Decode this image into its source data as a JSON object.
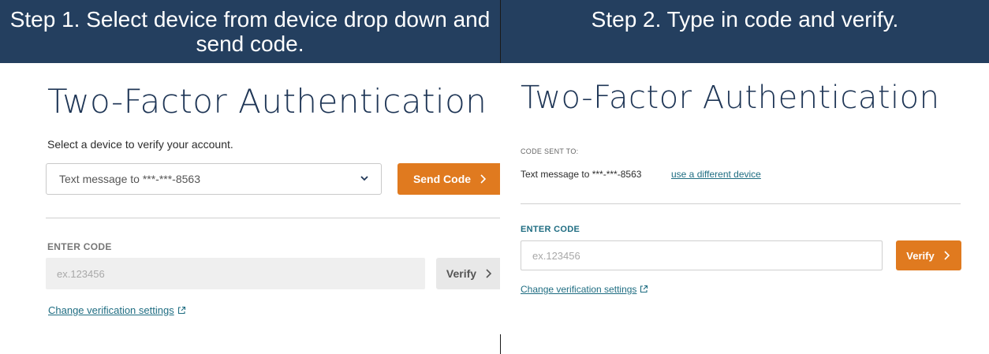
{
  "header": {
    "step1": "Step 1. Select device from device drop down and send code.",
    "step2": "Step 2. Type in code and verify."
  },
  "left": {
    "title": "Two-Factor Authentication",
    "instruction": "Select a device to verify your account.",
    "device_select": {
      "selected": "Text message to ***-***-8563",
      "icon": "chevron-down-icon"
    },
    "send_code_label": "Send Code",
    "enter_code_label": "ENTER CODE",
    "code_input_placeholder": "ex.123456",
    "verify_label": "Verify",
    "change_settings_link": "Change verification settings"
  },
  "right": {
    "title": "Two-Factor Authentication",
    "code_sent_to_label": "CODE SENT TO:",
    "sent_device": "Text message to ***-***-8563",
    "different_device_link": "use a different device",
    "enter_code_label": "ENTER CODE",
    "code_input_placeholder": "ex.123456",
    "verify_label": "Verify",
    "change_settings_link": "Change verification settings"
  },
  "colors": {
    "header_bg": "#243f5f",
    "title": "#1f3656",
    "accent_orange": "#e07a1f",
    "link": "#1f6d82",
    "disabled_grey": "#e8e8e8"
  }
}
